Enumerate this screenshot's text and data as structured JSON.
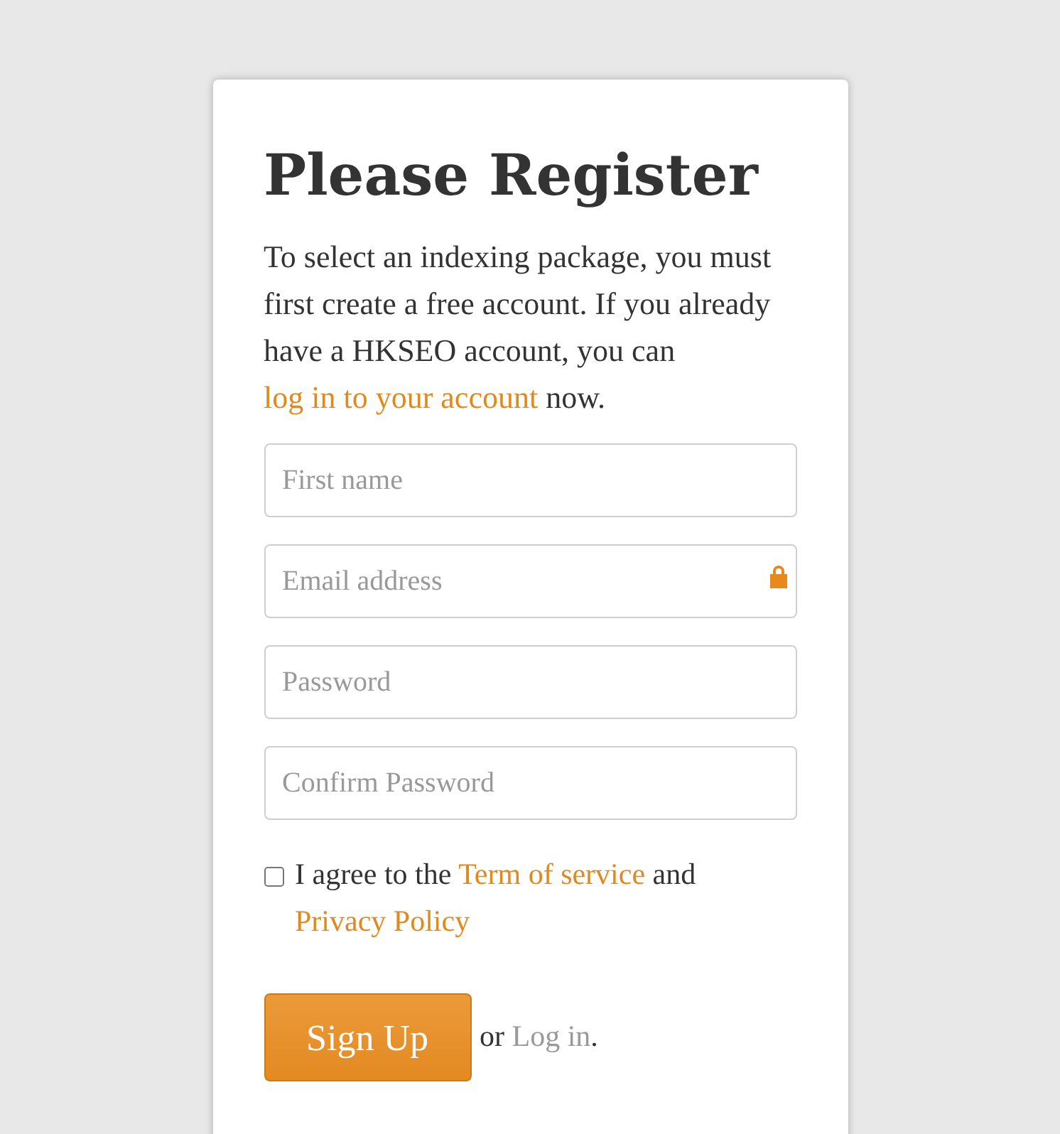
{
  "title": "Please Register",
  "intro": {
    "before": "To select an indexing package, you must first create a free account. If you already have a HKSEO account, you can ",
    "link": "log in to your account",
    "after": " now."
  },
  "fields": [
    {
      "placeholder": "First name",
      "locked": false
    },
    {
      "placeholder": "Email address",
      "locked": true
    },
    {
      "placeholder": "Password",
      "locked": false
    },
    {
      "placeholder": "Confirm Password",
      "locked": false
    }
  ],
  "agreement": {
    "checked": false,
    "before": "I agree to the ",
    "terms_link": "Term of service",
    "between": " and ",
    "privacy_link": "Privacy Policy"
  },
  "submit": {
    "label": "Sign Up",
    "or": "or ",
    "login_link": "Log in",
    "after": "."
  }
}
